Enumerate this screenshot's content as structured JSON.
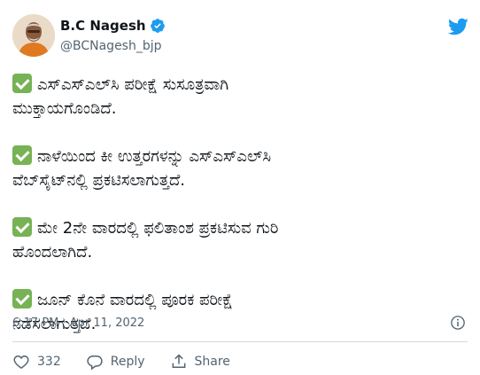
{
  "author": {
    "name": "B.C Nagesh",
    "handle": "@BCNagesh_bjp"
  },
  "tweet": {
    "paragraphs": [
      {
        "line1": "ಎಸ್‌ಎಸ್‌ಎಲ್‌ಸಿ ಪರೀಕ್ಷೆ ಸುಸೂತ್ರವಾಗಿ",
        "line2": "ಮುಕ್ತಾಯಗೊಂಡಿದೆ."
      },
      {
        "line1": "ನಾಳೆಯಿಂದ ಕೀ ಉತ್ತರಗಳನ್ನು ಎಸ್‌ಎಸ್‌ಎಲ್‌ಸಿ",
        "line2": "ವೆಬ್‌ಸೈಟ್‌ನಲ್ಲಿ ಪ್ರಕಟಿಸಲಾಗುತ್ತದೆ."
      },
      {
        "line1": "ಮೇ 2ನೇ ವಾರದಲ್ಲಿ ಫಲಿತಾಂಶ ಪ್ರಕಟಿಸುವ ಗುರಿ",
        "line2": "ಹೊಂದಲಾಗಿದೆ."
      },
      {
        "line1": "ಜೂನ್ ಕೊನೆ ವಾರದಲ್ಲಿ ಪೂರಕ ಪರೀಕ್ಷೆ",
        "line2": "ನಡೆಸಲಾಗುತ್ತದೆ."
      }
    ],
    "timestamp": "6:17 PM · Apr 11, 2022"
  },
  "actions": {
    "like_count": "332",
    "reply_label": "Reply",
    "share_label": "Share"
  },
  "colors": {
    "verified": "#1d9bf0",
    "twitter_blue": "#1d9bf0",
    "check_green": "#77b255",
    "muted": "#536471"
  }
}
